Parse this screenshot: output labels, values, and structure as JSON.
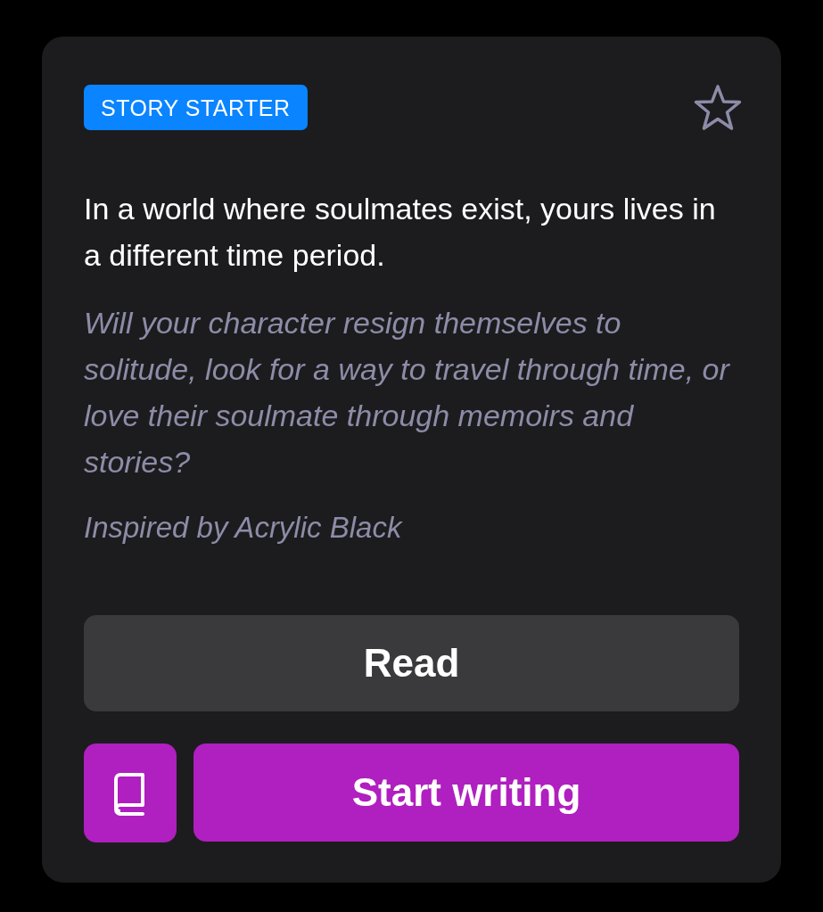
{
  "card": {
    "badge": "STORY STARTER",
    "favorited": false,
    "title": "In a world where soulmates exist, yours lives in a different time period.",
    "description": "Will your character resign themselves to solitude, look for a way to travel through time, or love their soulmate through memoirs and stories?",
    "credit": "Inspired by Acrylic Black",
    "buttons": [
      {
        "kind": "secondary",
        "label": "Read"
      },
      {
        "kind": "book"
      },
      {
        "kind": "primary",
        "label": "Start writing"
      }
    ]
  }
}
